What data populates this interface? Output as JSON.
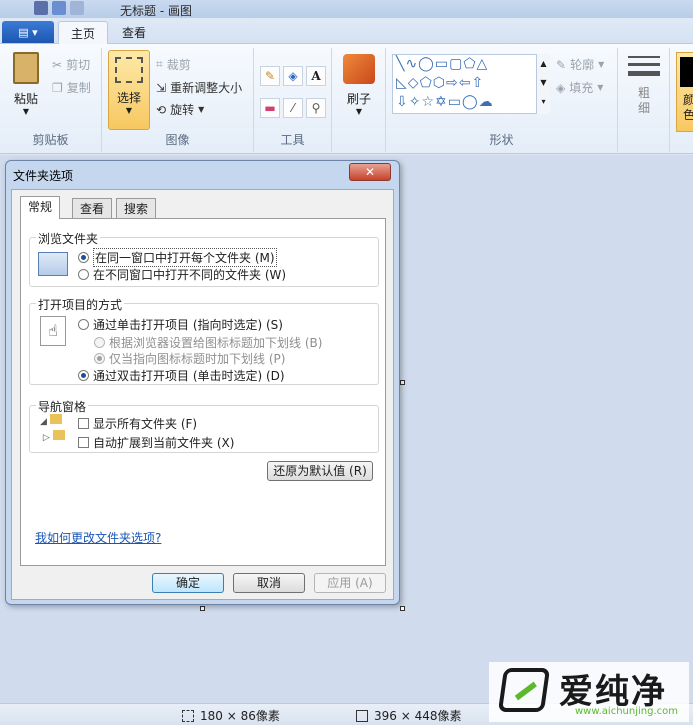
{
  "window": {
    "title": "无标题 - 画图"
  },
  "tabs": {
    "app_menu": "▤ ▾",
    "home": "主页",
    "view": "查看"
  },
  "ribbon": {
    "clipboard": {
      "label": "剪贴板",
      "paste": "粘贴",
      "cut": "剪切",
      "copy": "复制"
    },
    "image": {
      "label": "图像",
      "select": "选择",
      "crop": "裁剪",
      "resize": "重新调整大小",
      "rotate": "旋转"
    },
    "tools": {
      "label": "工具",
      "text_tool": "A"
    },
    "brushes": {
      "label": "刷子"
    },
    "shapes": {
      "label": "形状",
      "outline": "轮廓",
      "fill": "填充"
    },
    "size": {
      "label": "粗细"
    },
    "color1": {
      "label": "颜色"
    }
  },
  "dialog": {
    "title": "文件夹选项",
    "close": "✕",
    "tabs": [
      "常规",
      "查看",
      "搜索"
    ],
    "browse": {
      "legend": "浏览文件夹",
      "opt_same": "在同一窗口中打开每个文件夹 (M)",
      "opt_new": "在不同窗口中打开不同的文件夹 (W)"
    },
    "click": {
      "legend": "打开项目的方式",
      "opt_single": "通过单击打开项目 (指向时选定) (S)",
      "opt_browser": "根据浏览器设置给图标标题加下划线 (B)",
      "opt_point": "仅当指向图标标题时加下划线 (P)",
      "opt_double": "通过双击打开项目 (单击时选定) (D)"
    },
    "nav": {
      "legend": "导航窗格",
      "show_all": "显示所有文件夹 (F)",
      "auto_expand": "自动扩展到当前文件夹 (X)"
    },
    "restore": "还原为默认值 (R)",
    "help_link": "我如何更改文件夹选项?",
    "ok": "确定",
    "cancel": "取消",
    "apply": "应用 (A)"
  },
  "status": {
    "selection": "180 × 86像素",
    "canvas": "396 × 448像素"
  },
  "watermark": {
    "text": "爱纯净",
    "url": "www.aichunjing.com"
  }
}
